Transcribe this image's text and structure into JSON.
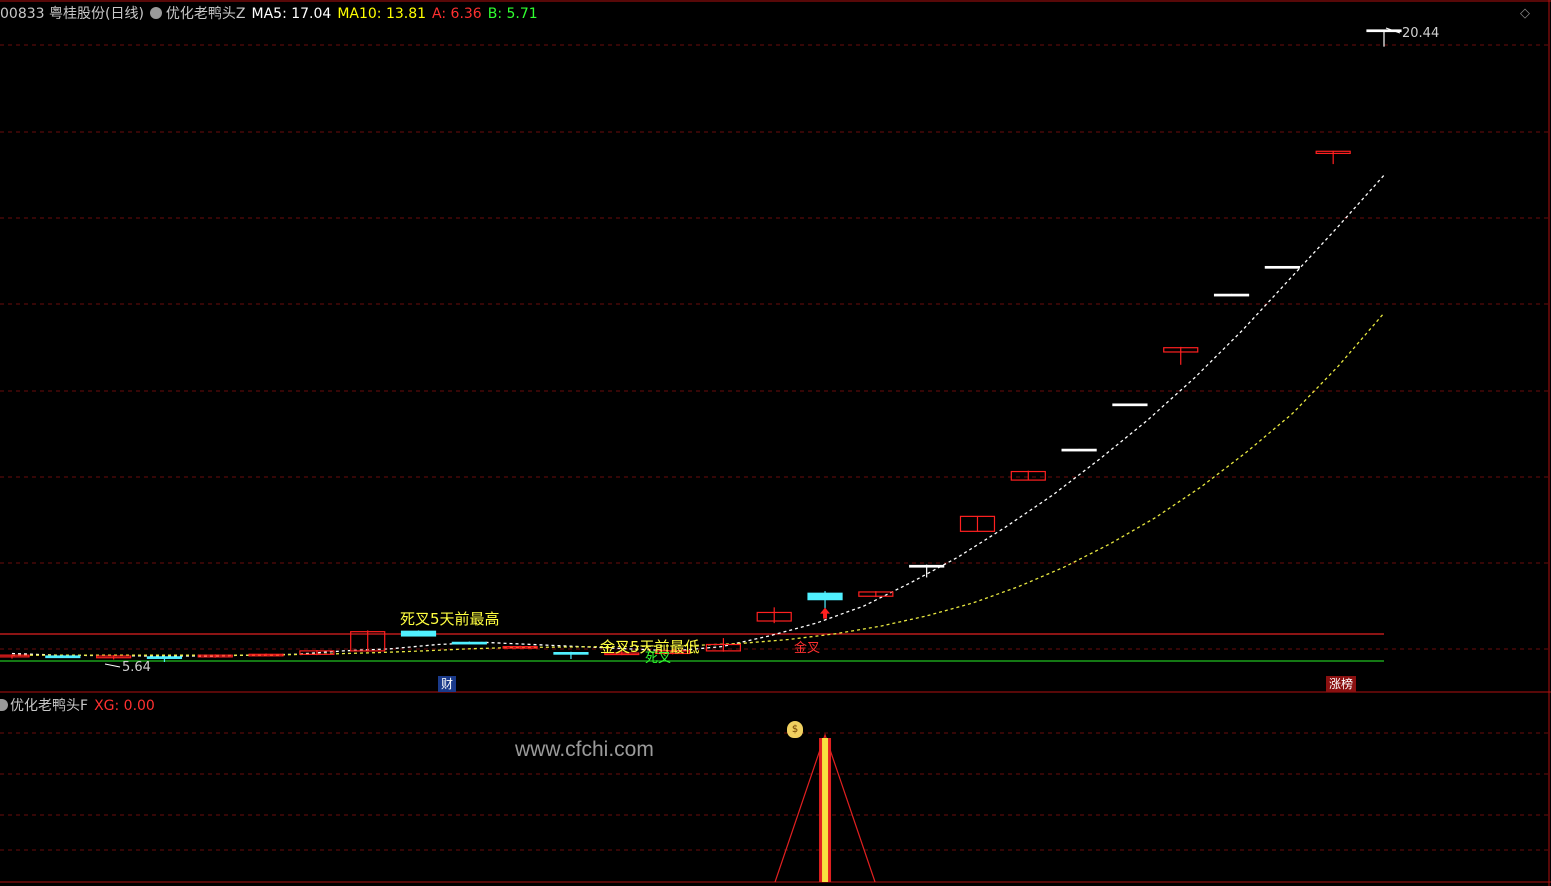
{
  "header": {
    "code_name": "00833 粤桂股份(日线)",
    "indicator": "优化老鸭头Z",
    "ma5": "MA5: 17.04",
    "ma10": "MA10: 13.81",
    "a": "A: 6.36",
    "b": "B: 5.71",
    "colors": {
      "ma5": "#ffffff",
      "ma10": "#ffff00",
      "a": "#ff3030",
      "b": "#30ff30"
    }
  },
  "price_labels": {
    "high": "20.44",
    "low": "5.64"
  },
  "annotations": {
    "death_cross": "死叉5天前最高",
    "golden_cross": "金叉5天前最低",
    "golden_cross_small": "金叉",
    "death_cross_small": "死叉"
  },
  "markers": {
    "cai": "财",
    "zhangbang": "涨榜"
  },
  "sub_panel": {
    "title": "优化老鸭头F",
    "xg": "XG: 0.00"
  },
  "watermark": "www.cfchi.com",
  "icons": {
    "corner": "diamond-icon",
    "panel": "circle-icon",
    "signal": "money-bag-icon"
  },
  "chart_data": {
    "type": "candlestick",
    "price_range": [
      5.64,
      20.44
    ],
    "candles": [
      {
        "o": 5.8,
        "c": 5.76,
        "h": 5.82,
        "l": 5.72,
        "color": "red"
      },
      {
        "o": 5.76,
        "c": 5.78,
        "h": 5.8,
        "l": 5.74,
        "color": "cyan"
      },
      {
        "o": 5.78,
        "c": 5.74,
        "h": 5.8,
        "l": 5.7,
        "color": "red"
      },
      {
        "o": 5.74,
        "c": 5.76,
        "h": 5.78,
        "l": 5.64,
        "color": "cyan"
      },
      {
        "o": 5.76,
        "c": 5.8,
        "h": 5.82,
        "l": 5.74,
        "color": "red"
      },
      {
        "o": 5.8,
        "c": 5.82,
        "h": 5.84,
        "l": 5.78,
        "color": "red"
      },
      {
        "o": 5.82,
        "c": 5.9,
        "h": 5.92,
        "l": 5.8,
        "color": "red"
      },
      {
        "o": 5.9,
        "c": 6.35,
        "h": 6.38,
        "l": 5.88,
        "color": "red"
      },
      {
        "o": 6.36,
        "c": 6.25,
        "h": 6.38,
        "l": 6.24,
        "color": "cyan"
      },
      {
        "o": 6.1,
        "c": 6.08,
        "h": 6.12,
        "l": 6.06,
        "color": "cyan"
      },
      {
        "o": 6.0,
        "c": 6.0,
        "h": 6.02,
        "l": 5.98,
        "color": "red"
      },
      {
        "o": 5.86,
        "c": 5.83,
        "h": 5.88,
        "l": 5.71,
        "color": "cyan"
      },
      {
        "o": 5.85,
        "c": 5.84,
        "h": 5.9,
        "l": 5.8,
        "color": "red"
      },
      {
        "o": 5.84,
        "c": 5.9,
        "h": 5.94,
        "l": 5.82,
        "color": "red"
      },
      {
        "o": 5.9,
        "c": 6.05,
        "h": 6.2,
        "l": 5.88,
        "color": "red"
      },
      {
        "o": 6.6,
        "c": 6.8,
        "h": 6.92,
        "l": 6.55,
        "color": "red"
      },
      {
        "o": 7.25,
        "c": 7.1,
        "h": 7.3,
        "l": 6.82,
        "color": "cyan"
      },
      {
        "o": 7.18,
        "c": 7.28,
        "h": 7.3,
        "l": 7.16,
        "color": "red"
      },
      {
        "o": 7.9,
        "c": 7.9,
        "h": 7.92,
        "l": 7.62,
        "color": "white"
      },
      {
        "o": 8.7,
        "c": 9.05,
        "h": 9.06,
        "l": 8.69,
        "color": "red"
      },
      {
        "o": 9.9,
        "c": 10.1,
        "h": 10.12,
        "l": 9.89,
        "color": "red"
      },
      {
        "o": 10.62,
        "c": 10.62,
        "h": 10.63,
        "l": 10.61,
        "color": "white"
      },
      {
        "o": 11.68,
        "c": 11.68,
        "h": 11.69,
        "l": 11.67,
        "color": "white"
      },
      {
        "o": 12.9,
        "c": 13.0,
        "h": 13.02,
        "l": 12.6,
        "color": "red"
      },
      {
        "o": 14.25,
        "c": 14.25,
        "h": 14.26,
        "l": 14.24,
        "color": "white"
      },
      {
        "o": 14.9,
        "c": 14.9,
        "h": 14.91,
        "l": 14.89,
        "color": "white"
      },
      {
        "o": 17.55,
        "c": 17.6,
        "h": 17.61,
        "l": 17.3,
        "color": "red"
      },
      {
        "o": 20.44,
        "c": 20.44,
        "h": 20.44,
        "l": 20.05,
        "color": "white"
      }
    ],
    "ma5_line": [
      5.84,
      5.8,
      5.79,
      5.78,
      5.78,
      5.8,
      5.82,
      5.9,
      5.95,
      6.05,
      6.1,
      6.05,
      6.0,
      5.95,
      5.9,
      6.0,
      6.25,
      6.55,
      6.95,
      7.5,
      8.1,
      8.8,
      9.55,
      10.4,
      11.3,
      12.3,
      13.4,
      14.6,
      15.8,
      17.04
    ],
    "ma10_line": [
      5.8,
      5.8,
      5.8,
      5.8,
      5.8,
      5.8,
      5.81,
      5.83,
      5.86,
      5.9,
      5.95,
      5.98,
      5.99,
      6.0,
      6.01,
      6.03,
      6.08,
      6.17,
      6.3,
      6.48,
      6.72,
      7.02,
      7.4,
      7.86,
      8.4,
      9.02,
      9.74,
      10.56,
      11.46,
      12.57,
      13.81
    ],
    "a_level": 6.36,
    "b_level": 5.71,
    "xg_signal": {
      "index": 16,
      "value": 1
    }
  }
}
